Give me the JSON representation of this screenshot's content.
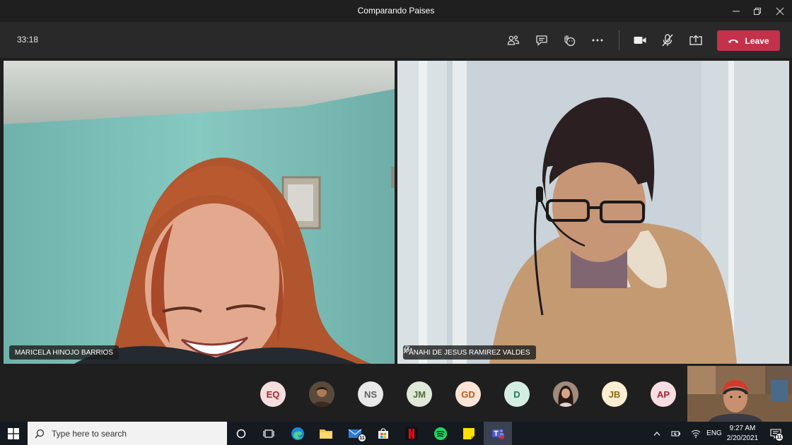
{
  "window": {
    "title": "Comparando Paises"
  },
  "toolbar": {
    "timer": "33:18",
    "leave_label": "Leave"
  },
  "participants": [
    {
      "name": "MARICELA HINOJO BARRIOS"
    },
    {
      "name": "ANAHI DE JESUS RAMIREZ VALDES"
    }
  ],
  "roster": [
    {
      "initials": "EQ",
      "bg": "#f7dede",
      "fg": "#a4262c"
    },
    {
      "initials": "",
      "bg": "#5a4a3a",
      "fg": "#ffffff"
    },
    {
      "initials": "NS",
      "bg": "#e8e8e8",
      "fg": "#616161"
    },
    {
      "initials": "JM",
      "bg": "#e0e8da",
      "fg": "#4f6b3d"
    },
    {
      "initials": "GD",
      "bg": "#fbe4d6",
      "fg": "#b85c1e"
    },
    {
      "initials": "D",
      "bg": "#d5eee4",
      "fg": "#1f7a56"
    },
    {
      "initials": "",
      "bg": "#8a6a58",
      "fg": "#ffffff"
    },
    {
      "initials": "JB",
      "bg": "#fbeed2",
      "fg": "#8a6a12"
    },
    {
      "initials": "AP",
      "bg": "#f8dde3",
      "fg": "#a4262c"
    }
  ],
  "taskbar": {
    "search_placeholder": "Type here to search",
    "mail_badge": "11",
    "lang": "ENG",
    "time": "9:27 AM",
    "date": "2/20/2021",
    "notif_badge": "11"
  }
}
